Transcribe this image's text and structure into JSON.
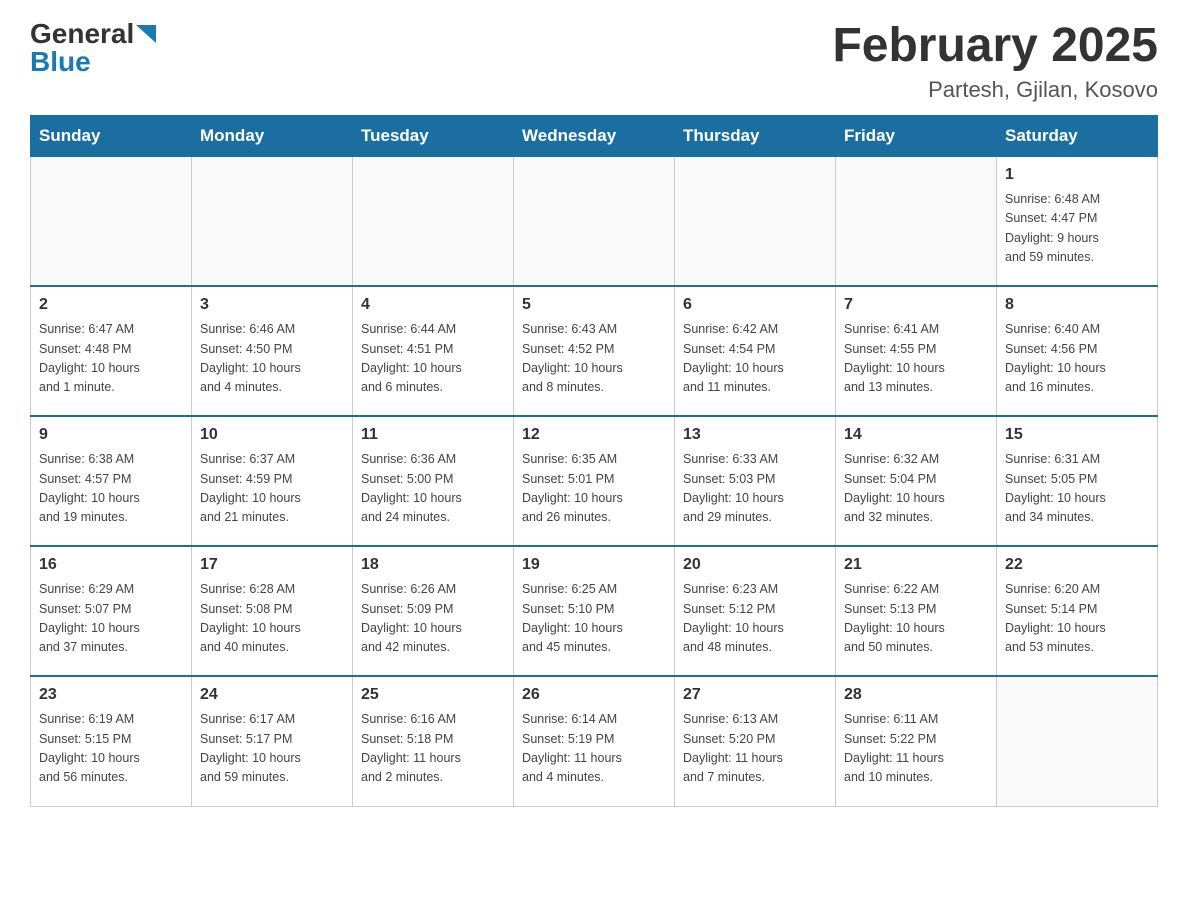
{
  "header": {
    "logo_general": "General",
    "logo_blue": "Blue",
    "month_title": "February 2025",
    "location": "Partesh, Gjilan, Kosovo"
  },
  "weekdays": [
    "Sunday",
    "Monday",
    "Tuesday",
    "Wednesday",
    "Thursday",
    "Friday",
    "Saturday"
  ],
  "weeks": [
    [
      {
        "day": "",
        "info": ""
      },
      {
        "day": "",
        "info": ""
      },
      {
        "day": "",
        "info": ""
      },
      {
        "day": "",
        "info": ""
      },
      {
        "day": "",
        "info": ""
      },
      {
        "day": "",
        "info": ""
      },
      {
        "day": "1",
        "info": "Sunrise: 6:48 AM\nSunset: 4:47 PM\nDaylight: 9 hours\nand 59 minutes."
      }
    ],
    [
      {
        "day": "2",
        "info": "Sunrise: 6:47 AM\nSunset: 4:48 PM\nDaylight: 10 hours\nand 1 minute."
      },
      {
        "day": "3",
        "info": "Sunrise: 6:46 AM\nSunset: 4:50 PM\nDaylight: 10 hours\nand 4 minutes."
      },
      {
        "day": "4",
        "info": "Sunrise: 6:44 AM\nSunset: 4:51 PM\nDaylight: 10 hours\nand 6 minutes."
      },
      {
        "day": "5",
        "info": "Sunrise: 6:43 AM\nSunset: 4:52 PM\nDaylight: 10 hours\nand 8 minutes."
      },
      {
        "day": "6",
        "info": "Sunrise: 6:42 AM\nSunset: 4:54 PM\nDaylight: 10 hours\nand 11 minutes."
      },
      {
        "day": "7",
        "info": "Sunrise: 6:41 AM\nSunset: 4:55 PM\nDaylight: 10 hours\nand 13 minutes."
      },
      {
        "day": "8",
        "info": "Sunrise: 6:40 AM\nSunset: 4:56 PM\nDaylight: 10 hours\nand 16 minutes."
      }
    ],
    [
      {
        "day": "9",
        "info": "Sunrise: 6:38 AM\nSunset: 4:57 PM\nDaylight: 10 hours\nand 19 minutes."
      },
      {
        "day": "10",
        "info": "Sunrise: 6:37 AM\nSunset: 4:59 PM\nDaylight: 10 hours\nand 21 minutes."
      },
      {
        "day": "11",
        "info": "Sunrise: 6:36 AM\nSunset: 5:00 PM\nDaylight: 10 hours\nand 24 minutes."
      },
      {
        "day": "12",
        "info": "Sunrise: 6:35 AM\nSunset: 5:01 PM\nDaylight: 10 hours\nand 26 minutes."
      },
      {
        "day": "13",
        "info": "Sunrise: 6:33 AM\nSunset: 5:03 PM\nDaylight: 10 hours\nand 29 minutes."
      },
      {
        "day": "14",
        "info": "Sunrise: 6:32 AM\nSunset: 5:04 PM\nDaylight: 10 hours\nand 32 minutes."
      },
      {
        "day": "15",
        "info": "Sunrise: 6:31 AM\nSunset: 5:05 PM\nDaylight: 10 hours\nand 34 minutes."
      }
    ],
    [
      {
        "day": "16",
        "info": "Sunrise: 6:29 AM\nSunset: 5:07 PM\nDaylight: 10 hours\nand 37 minutes."
      },
      {
        "day": "17",
        "info": "Sunrise: 6:28 AM\nSunset: 5:08 PM\nDaylight: 10 hours\nand 40 minutes."
      },
      {
        "day": "18",
        "info": "Sunrise: 6:26 AM\nSunset: 5:09 PM\nDaylight: 10 hours\nand 42 minutes."
      },
      {
        "day": "19",
        "info": "Sunrise: 6:25 AM\nSunset: 5:10 PM\nDaylight: 10 hours\nand 45 minutes."
      },
      {
        "day": "20",
        "info": "Sunrise: 6:23 AM\nSunset: 5:12 PM\nDaylight: 10 hours\nand 48 minutes."
      },
      {
        "day": "21",
        "info": "Sunrise: 6:22 AM\nSunset: 5:13 PM\nDaylight: 10 hours\nand 50 minutes."
      },
      {
        "day": "22",
        "info": "Sunrise: 6:20 AM\nSunset: 5:14 PM\nDaylight: 10 hours\nand 53 minutes."
      }
    ],
    [
      {
        "day": "23",
        "info": "Sunrise: 6:19 AM\nSunset: 5:15 PM\nDaylight: 10 hours\nand 56 minutes."
      },
      {
        "day": "24",
        "info": "Sunrise: 6:17 AM\nSunset: 5:17 PM\nDaylight: 10 hours\nand 59 minutes."
      },
      {
        "day": "25",
        "info": "Sunrise: 6:16 AM\nSunset: 5:18 PM\nDaylight: 11 hours\nand 2 minutes."
      },
      {
        "day": "26",
        "info": "Sunrise: 6:14 AM\nSunset: 5:19 PM\nDaylight: 11 hours\nand 4 minutes."
      },
      {
        "day": "27",
        "info": "Sunrise: 6:13 AM\nSunset: 5:20 PM\nDaylight: 11 hours\nand 7 minutes."
      },
      {
        "day": "28",
        "info": "Sunrise: 6:11 AM\nSunset: 5:22 PM\nDaylight: 11 hours\nand 10 minutes."
      },
      {
        "day": "",
        "info": ""
      }
    ]
  ]
}
